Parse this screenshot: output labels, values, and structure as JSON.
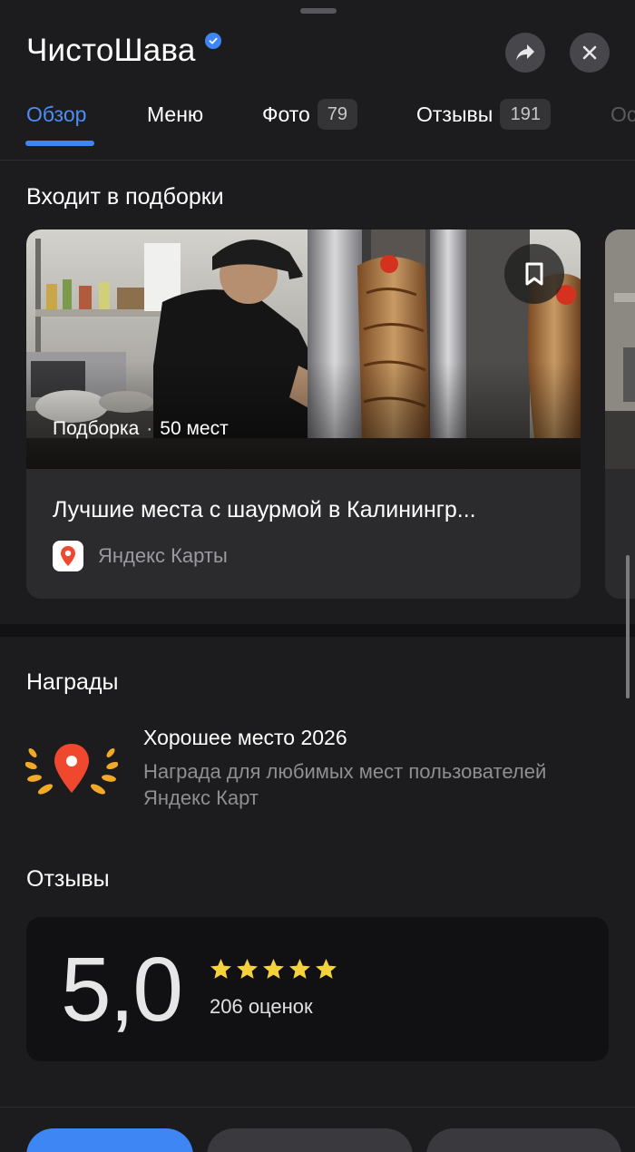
{
  "header": {
    "title": "ЧистоШава",
    "verified": true,
    "share_icon": "share-arrow-icon",
    "close_icon": "close-icon"
  },
  "tabs": [
    {
      "label": "Обзор",
      "active": true
    },
    {
      "label": "Меню"
    },
    {
      "label": "Фото",
      "badge": "79"
    },
    {
      "label": "Отзывы",
      "badge": "191"
    },
    {
      "label": "Ос"
    }
  ],
  "collections": {
    "title": "Входит в подборки",
    "card": {
      "meta_type": "Подборка",
      "meta_separator": "·",
      "meta_count": "50 мест",
      "title": "Лучшие места с шаурмой в Калинингр...",
      "source": "Яндекс Карты",
      "bookmark_icon": "bookmark-icon"
    }
  },
  "awards": {
    "title": "Награды",
    "item": {
      "name": "Хорошее место 2026",
      "description": "Награда для любимых мест пользователей Яндекс Карт"
    }
  },
  "reviews": {
    "title": "Отзывы",
    "rating": "5,0",
    "stars": 5,
    "count_text": "206 оценок"
  },
  "colors": {
    "accent": "#3f86f5",
    "background": "#1c1c1e",
    "star": "#f5d23b",
    "award_pin": "#f0482f",
    "laurel": "#f3a928"
  }
}
